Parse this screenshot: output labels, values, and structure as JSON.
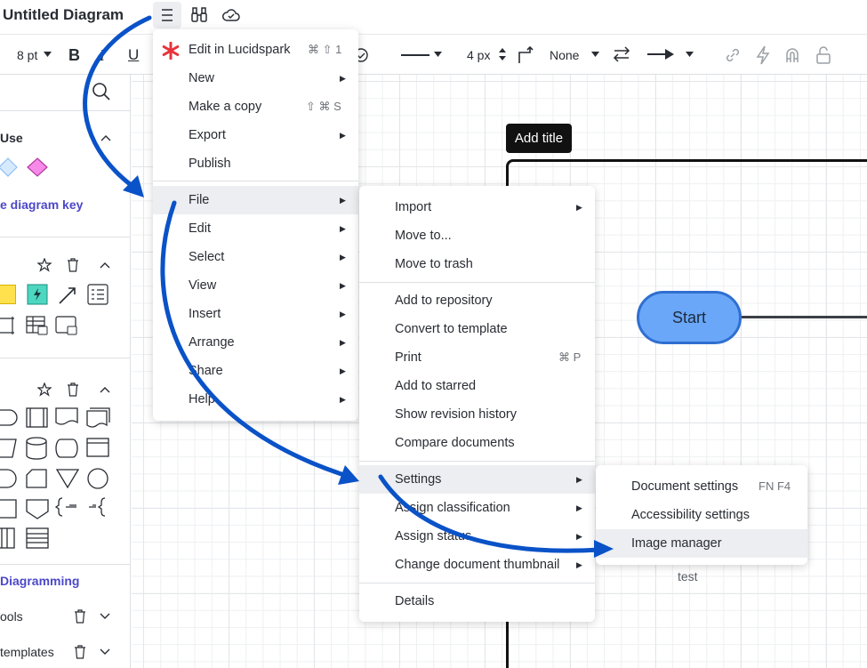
{
  "header": {
    "title": "Untitled Diagram"
  },
  "toolbar": {
    "font_size": "8 pt",
    "bold": "B",
    "italic": "I",
    "underline": "U",
    "line_width": "4 px",
    "endpoint_start": "None"
  },
  "left_panel": {
    "section_use_title": "Use",
    "diagram_key_link": "e diagram key",
    "diagramming_link": "Diagramming",
    "tools_label": "ools",
    "templates_label": "templates"
  },
  "canvas": {
    "add_title": "Add title",
    "start_label": "Start",
    "test_label": "test"
  },
  "main_menu": {
    "items": [
      {
        "label": "Edit in Lucidspark",
        "shortcut": "⌘ ⇧ 1"
      },
      {
        "label": "New"
      },
      {
        "label": "Make a copy",
        "shortcut": "⇧ ⌘ S"
      },
      {
        "label": "Export"
      },
      {
        "label": "Publish"
      },
      {
        "label": "File"
      },
      {
        "label": "Edit"
      },
      {
        "label": "Select"
      },
      {
        "label": "View"
      },
      {
        "label": "Insert"
      },
      {
        "label": "Arrange"
      },
      {
        "label": "Share"
      },
      {
        "label": "Help"
      }
    ]
  },
  "file_menu": {
    "items": [
      {
        "label": "Import"
      },
      {
        "label": "Move to..."
      },
      {
        "label": "Move to trash"
      },
      {
        "label": "Add to repository"
      },
      {
        "label": "Convert to template"
      },
      {
        "label": "Print",
        "shortcut": "⌘ P"
      },
      {
        "label": "Add to starred"
      },
      {
        "label": "Show revision history"
      },
      {
        "label": "Compare documents"
      },
      {
        "label": "Settings"
      },
      {
        "label": "Assign classification"
      },
      {
        "label": "Assign status"
      },
      {
        "label": "Change document thumbnail"
      },
      {
        "label": "Details"
      }
    ]
  },
  "settings_menu": {
    "items": [
      {
        "label": "Document settings",
        "shortcut": "FN F4"
      },
      {
        "label": "Accessibility settings"
      },
      {
        "label": "Image manager"
      }
    ]
  },
  "colors": {
    "accent_link": "#4c48c9",
    "start_fill": "#6aa7f8",
    "start_border": "#2f6fd0",
    "annotation_arrow": "#0a52c7",
    "lucidspark_star": "#e8323c"
  }
}
